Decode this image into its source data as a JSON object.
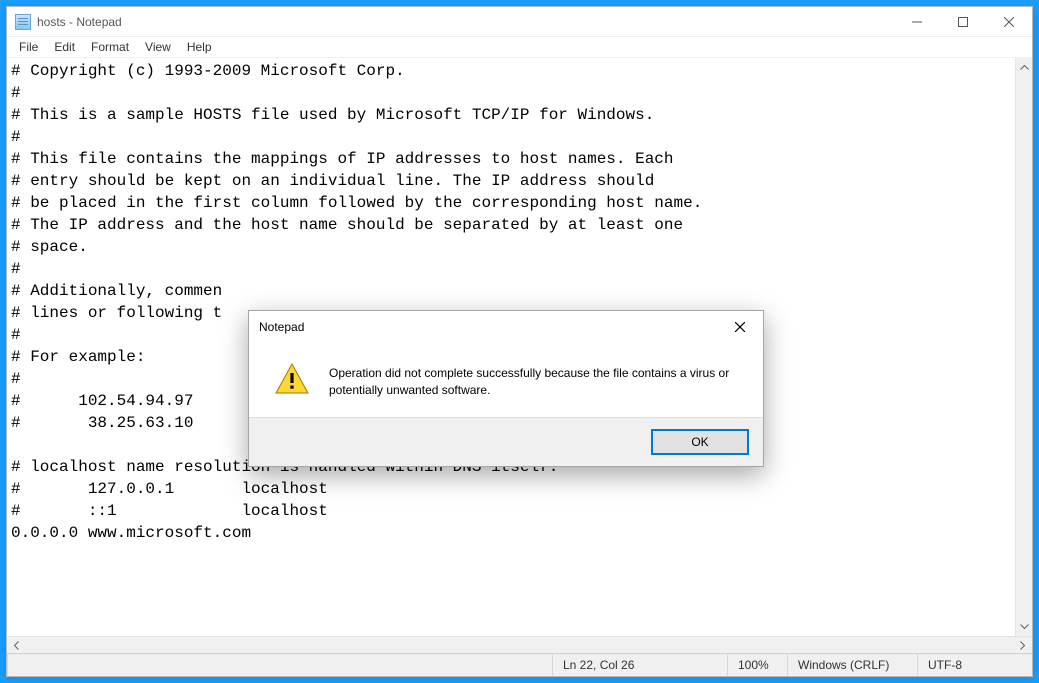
{
  "window": {
    "title": "hosts - Notepad"
  },
  "menu": {
    "file": "File",
    "edit": "Edit",
    "format": "Format",
    "view": "View",
    "help": "Help"
  },
  "editor": {
    "content": "# Copyright (c) 1993-2009 Microsoft Corp.\n#\n# This is a sample HOSTS file used by Microsoft TCP/IP for Windows.\n#\n# This file contains the mappings of IP addresses to host names. Each\n# entry should be kept on an individual line. The IP address should\n# be placed in the first column followed by the corresponding host name.\n# The IP address and the host name should be separated by at least one\n# space.\n#\n# Additionally, commen\n# lines or following t\n#\n# For example:\n#\n#      102.54.94.97\n#       38.25.63.10\n\n# localhost name resolution is handled within DNS itself.\n#       127.0.0.1       localhost\n#       ::1             localhost\n0.0.0.0 www.microsoft.com"
  },
  "status": {
    "position": "Ln 22, Col 26",
    "zoom": "100%",
    "line_ending": "Windows (CRLF)",
    "encoding": "UTF-8"
  },
  "dialog": {
    "title": "Notepad",
    "message": "Operation did not complete successfully because the file contains a virus or potentially unwanted software.",
    "ok": "OK"
  }
}
